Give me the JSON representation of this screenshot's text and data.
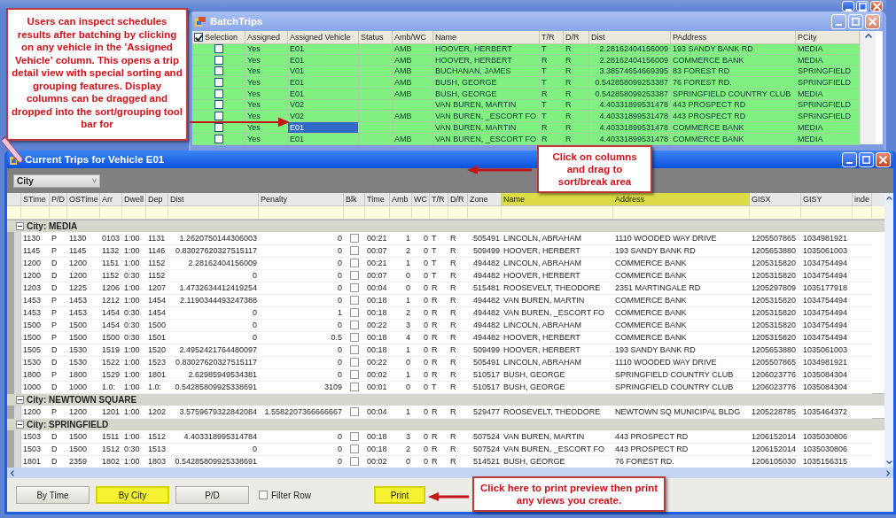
{
  "batch_window": {
    "title": "BatchTrips",
    "select_all_checked": true,
    "columns": [
      {
        "label": "Selection",
        "kind": "check"
      },
      {
        "label": "Assigned",
        "kind": "text"
      },
      {
        "label": "Assigned Vehicle",
        "kind": "text"
      },
      {
        "label": "Status",
        "kind": "text"
      },
      {
        "label": "Amb/WC",
        "kind": "text"
      },
      {
        "label": "Name",
        "kind": "text"
      },
      {
        "label": "T/R",
        "kind": "text"
      },
      {
        "label": "D/R",
        "kind": "text"
      },
      {
        "label": "Dist",
        "kind": "number"
      },
      {
        "label": "PAddress",
        "kind": "text"
      },
      {
        "label": "PCity",
        "kind": "text"
      }
    ],
    "rows": [
      {
        "checked": false,
        "assigned": "Yes",
        "vehicle": "E01",
        "vehicle_selected": false,
        "amb_wc": "AMB",
        "name": "HOOVER, HERBERT",
        "t_r": "T",
        "d_r": "R",
        "dist": "2.28162404156009",
        "paddress": "193 SANDY BANK RD",
        "pcity": "MEDIA"
      },
      {
        "checked": false,
        "assigned": "Yes",
        "vehicle": "E01",
        "vehicle_selected": false,
        "amb_wc": "AMB",
        "name": "HOOVER, HERBERT",
        "t_r": "R",
        "d_r": "R",
        "dist": "2.28162404156009",
        "paddress": "COMMERCE BANK",
        "pcity": "MEDIA"
      },
      {
        "checked": false,
        "assigned": "Yes",
        "vehicle": "V01",
        "vehicle_selected": false,
        "amb_wc": "AMB",
        "name": "BUCHANAN, JAMES",
        "t_r": "T",
        "d_r": "R",
        "dist": "3.38574654669395",
        "paddress": "83 FOREST RD",
        "pcity": "SPRINGFIELD"
      },
      {
        "checked": false,
        "assigned": "Yes",
        "vehicle": "E01",
        "vehicle_selected": false,
        "amb_wc": "AMB",
        "name": "BUSH, GEORGE",
        "t_r": "T",
        "d_r": "R",
        "dist": "0.542858099253387",
        "paddress": "76 FOREST RD.",
        "pcity": "SPRINGFIELD"
      },
      {
        "checked": false,
        "assigned": "Yes",
        "vehicle": "E01",
        "vehicle_selected": false,
        "amb_wc": "AMB",
        "name": "BUSH, GEORGE",
        "t_r": "R",
        "d_r": "R",
        "dist": "0.542858099253387",
        "paddress": "SPRINGFIELD COUNTRY CLUB",
        "pcity": "MEDIA"
      },
      {
        "checked": false,
        "assigned": "Yes",
        "vehicle": "V02",
        "vehicle_selected": false,
        "name": "VAN BUREN, MARTIN",
        "t_r": "T",
        "d_r": "R",
        "dist": "4.40331899531478",
        "paddress": "443 PROSPECT RD",
        "pcity": "SPRINGFIELD"
      },
      {
        "checked": false,
        "assigned": "Yes",
        "vehicle": "V02",
        "vehicle_selected": false,
        "amb_wc": "AMB",
        "name": "VAN BUREN, _ESCORT FO",
        "t_r": "T",
        "d_r": "R",
        "dist": "4.40331899531478",
        "paddress": "443 PROSPECT RD",
        "pcity": "SPRINGFIELD"
      },
      {
        "checked": false,
        "assigned": "Yes",
        "vehicle": "E01",
        "vehicle_selected": true,
        "name": "VAN BUREN, MARTIN",
        "t_r": "R",
        "d_r": "R",
        "dist": "4.40331899531478",
        "paddress": "COMMERCE BANK",
        "pcity": "MEDIA"
      },
      {
        "checked": false,
        "assigned": "Yes",
        "vehicle": "E01",
        "vehicle_selected": false,
        "amb_wc": "AMB",
        "name": "VAN BUREN, _ESCORT FO",
        "t_r": "R",
        "d_r": "R",
        "dist": "4.40331899531478",
        "paddress": "COMMERCE BANK",
        "pcity": "MEDIA"
      }
    ]
  },
  "trips_window": {
    "title": "Current Trips for Vehicle E01",
    "group_by": [
      {
        "label": "City"
      }
    ],
    "columns": [
      {
        "label": "STime",
        "kind": "text",
        "highlighted": false
      },
      {
        "label": "P/D",
        "kind": "text",
        "highlighted": false
      },
      {
        "label": "OSTime",
        "kind": "text",
        "highlighted": false
      },
      {
        "label": "Arr",
        "kind": "text",
        "highlighted": false
      },
      {
        "label": "Dwell",
        "kind": "text",
        "highlighted": false
      },
      {
        "label": "Dep",
        "kind": "text",
        "highlighted": false
      },
      {
        "label": "Dist",
        "kind": "number",
        "highlighted": false
      },
      {
        "label": "Penalty",
        "kind": "number",
        "highlighted": false
      },
      {
        "label": "Blk",
        "kind": "check",
        "highlighted": false
      },
      {
        "label": "Time",
        "kind": "text",
        "highlighted": false
      },
      {
        "label": "Amb",
        "kind": "number",
        "highlighted": false
      },
      {
        "label": "WC",
        "kind": "number",
        "highlighted": false
      },
      {
        "label": "T/R",
        "kind": "text",
        "highlighted": false
      },
      {
        "label": "D/R",
        "kind": "text",
        "highlighted": false
      },
      {
        "label": "Zone",
        "kind": "number",
        "highlighted": false
      },
      {
        "label": "Name",
        "kind": "text",
        "highlighted": true
      },
      {
        "label": "Address",
        "kind": "text",
        "highlighted": true
      },
      {
        "label": "GISX",
        "kind": "text",
        "highlighted": false
      },
      {
        "label": "GISY",
        "kind": "text",
        "highlighted": false
      },
      {
        "label": "inde",
        "kind": "text",
        "highlighted": false
      }
    ],
    "groups": [
      {
        "label": "City: MEDIA",
        "expanded": true,
        "rows": [
          {
            "blk_checked": false,
            "cells": [
              "1130",
              "P",
              "1130",
              "0103",
              "1:00",
              "1131",
              "1.2620750144306003",
              "0",
              "00:21",
              "1",
              "0",
              "T",
              "R",
              "505491",
              "LINCOLN, ABRAHAM",
              "1110 WOODED WAY DRIVE",
              "1205507865",
              "1034981921"
            ]
          },
          {
            "blk_checked": false,
            "cells": [
              "1145",
              "P",
              "1145",
              "1132",
              "1:00",
              "1146",
              "0.83027620327515117",
              "0",
              "00:07",
              "2",
              "0",
              "T",
              "R",
              "509499",
              "HOOVER, HERBERT",
              "193 SANDY BANK RD",
              "1205653880",
              "1035061003"
            ]
          },
          {
            "blk_checked": false,
            "cells": [
              "1200",
              "D",
              "1200",
              "1151",
              "1:00",
              "1152",
              "2.28162404156009",
              "0",
              "00:21",
              "1",
              "0",
              "T",
              "R",
              "494482",
              "LINCOLN, ABRAHAM",
              "COMMERCE BANK",
              "1205315820",
              "1034754494"
            ]
          },
          {
            "blk_checked": false,
            "cells": [
              "1200",
              "D",
              "1200",
              "1152",
              "0:30",
              "1152",
              "0",
              "0",
              "00:07",
              "0",
              "0",
              "T",
              "R",
              "494482",
              "HOOVER, HERBERT",
              "COMMERCE BANK",
              "1205315820",
              "1034754494"
            ]
          },
          {
            "blk_checked": false,
            "cells": [
              "1203",
              "D",
              "1225",
              "1206",
              "1:00",
              "1207",
              "1.4732634412419254",
              "0",
              "00:04",
              "0",
              "0",
              "R",
              "R",
              "515481",
              "ROOSEVELT, THEODORE",
              "2351 MARTINGALE RD",
              "1205297809",
              "1035177918"
            ]
          },
          {
            "blk_checked": false,
            "cells": [
              "1453",
              "P",
              "1453",
              "1212",
              "1:00",
              "1454",
              "2.1190344493247388",
              "0",
              "00:18",
              "1",
              "0",
              "R",
              "R",
              "494482",
              "VAN BUREN, MARTIN",
              "COMMERCE BANK",
              "1205315820",
              "1034754494"
            ]
          },
          {
            "blk_checked": false,
            "cells": [
              "1453",
              "P",
              "1453",
              "1454",
              "0:30",
              "1454",
              "0",
              "1",
              "00:18",
              "2",
              "0",
              "R",
              "R",
              "494482",
              "VAN BUREN, _ESCORT FO",
              "COMMERCE BANK",
              "1205315820",
              "1034754494"
            ]
          },
          {
            "blk_checked": false,
            "cells": [
              "1500",
              "P",
              "1500",
              "1454",
              "0:30",
              "1500",
              "0",
              "0",
              "00:22",
              "3",
              "0",
              "R",
              "R",
              "494482",
              "LINCOLN, ABRAHAM",
              "COMMERCE BANK",
              "1205315820",
              "1034754494"
            ]
          },
          {
            "blk_checked": false,
            "cells": [
              "1500",
              "P",
              "1500",
              "1500",
              "0:30",
              "1501",
              "0",
              "0.5",
              "00:18",
              "4",
              "0",
              "R",
              "R",
              "494482",
              "HOOVER, HERBERT",
              "COMMERCE BANK",
              "1205315820",
              "1034754494"
            ]
          },
          {
            "blk_checked": false,
            "cells": [
              "1505",
              "D",
              "1530",
              "1519",
              "1:00",
              "1520",
              "2.4952421764480097",
              "0",
              "00:18",
              "1",
              "0",
              "R",
              "R",
              "509499",
              "HOOVER, HERBERT",
              "193 SANDY BANK RD",
              "1205653880",
              "1035061003"
            ]
          },
          {
            "blk_checked": false,
            "cells": [
              "1530",
              "D",
              "1530",
              "1522",
              "1:00",
              "1523",
              "0.83027620327515117",
              "0",
              "00:22",
              "0",
              "0",
              "R",
              "R",
              "505491",
              "LINCOLN, ABRAHAM",
              "1110 WOODED WAY DRIVE",
              "1205507865",
              "1034981921"
            ]
          },
          {
            "blk_checked": false,
            "cells": [
              "1800",
              "P",
              "1800",
              "1529",
              "1:00",
              "1801",
              "2.62985949534381",
              "0",
              "00:02",
              "1",
              "0",
              "R",
              "R",
              "510517",
              "BUSH, GEORGE",
              "SPRINGFIELD COUNTRY CLUB",
              "1206023776",
              "1035084304"
            ]
          },
          {
            "blk_checked": false,
            "cells": [
              "1000",
              "D",
              "1000",
              "1.0:",
              "1:00",
              "1.0:",
              "0.54285809925338691",
              "3109",
              "00:01",
              "0",
              "0",
              "T",
              "R",
              "510517",
              "BUSH, GEORGE",
              "SPRINGFIELD COUNTRY CLUB",
              "1206023776",
              "1035084304"
            ]
          }
        ]
      },
      {
        "label": "City: NEWTOWN SQUARE",
        "expanded": true,
        "rows": [
          {
            "blk_checked": false,
            "cells": [
              "1200",
              "P",
              "1200",
              "1201",
              "1:00",
              "1202",
              "3.5759679322842084",
              "1.5582207366666667",
              "00:04",
              "1",
              "0",
              "R",
              "R",
              "529477",
              "ROOSEVELT, THEODORE",
              "NEWTOWN SQ MUNICIPAL BLDG",
              "1205228785",
              "1035464372"
            ]
          }
        ]
      },
      {
        "label": "City: SPRINGFIELD",
        "expanded": true,
        "rows": [
          {
            "blk_checked": false,
            "cells": [
              "1503",
              "D",
              "1500",
              "1511",
              "1:00",
              "1512",
              "4.403318995314784",
              "0",
              "00:18",
              "3",
              "0",
              "R",
              "R",
              "507524",
              "VAN BUREN, MARTIN",
              "443 PROSPECT RD",
              "1206152014",
              "1035030806"
            ]
          },
          {
            "blk_checked": false,
            "cells": [
              "1503",
              "D",
              "1500",
              "1512",
              "0:30",
              "1513",
              "0",
              "0",
              "00:18",
              "2",
              "0",
              "R",
              "R",
              "507524",
              "VAN BUREN, _ESCORT FO",
              "443 PROSPECT RD",
              "1206152014",
              "1035030806"
            ]
          },
          {
            "blk_checked": false,
            "cells": [
              "1801",
              "D",
              "2359",
              "1802",
              "1:00",
              "1803",
              "0.54285809925338691",
              "0",
              "00:02",
              "0",
              "0",
              "R",
              "R",
              "514521",
              "BUSH, GEORGE",
              "76 FOREST RD.",
              "1206105030",
              "1035156315"
            ]
          }
        ]
      }
    ],
    "buttons": [
      {
        "label": "By Time",
        "highlighted": false
      },
      {
        "label": "By City",
        "highlighted": true
      },
      {
        "label": "P/D",
        "highlighted": false
      }
    ],
    "filter_row": {
      "label": "Filter Row",
      "checked": false
    },
    "print_button": {
      "label": "Print",
      "highlighted": true
    }
  },
  "callouts": [
    {
      "text": "Users can inspect schedules results after batching by clicking on any vehicle in the 'Assigned Vehicle' column.  This opens a trip detail view with special sorting and grouping features. Display columns can be dragged and dropped into the sort/grouping tool bar for"
    },
    {
      "text": "Click on columns and drag to sort/break area"
    },
    {
      "text": "Click here to print preview then print any views you create."
    }
  ]
}
